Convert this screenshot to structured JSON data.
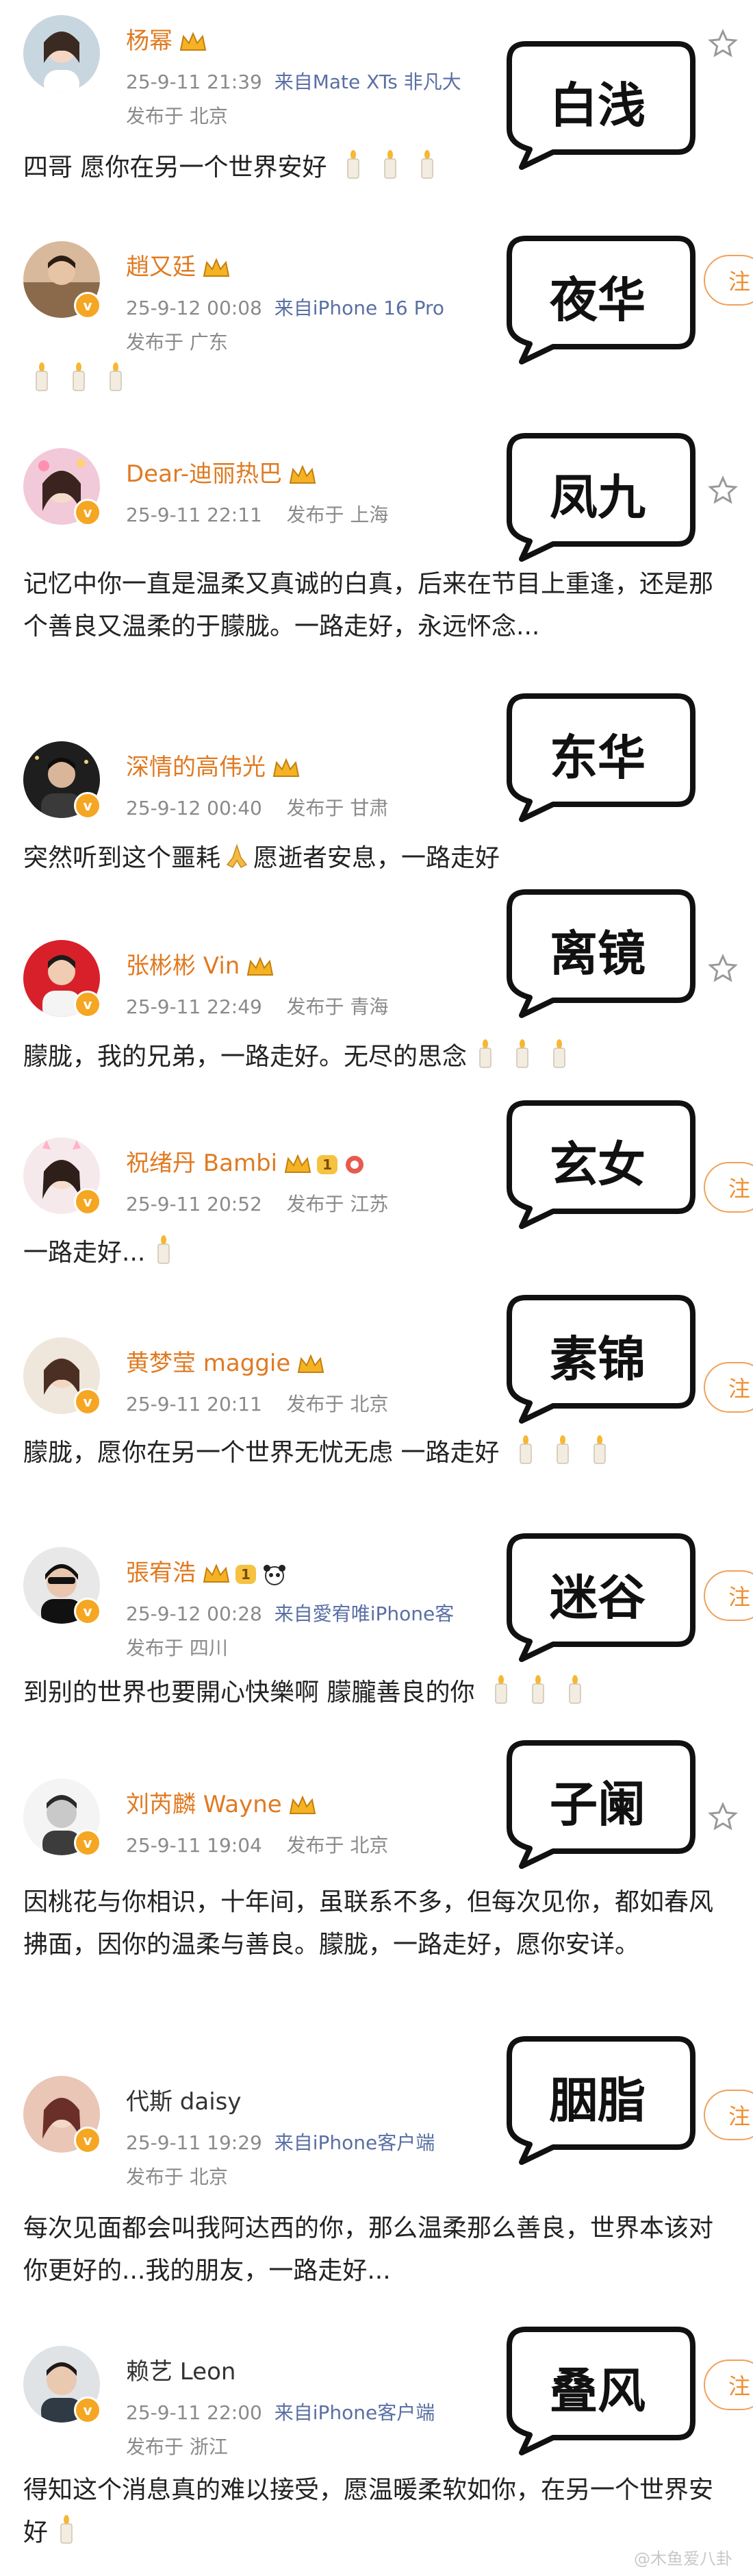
{
  "colors": {
    "username": "#e07a21",
    "badge": "#f5a623",
    "device": "#5a6fa3",
    "meta": "#8a8a8a"
  },
  "comments": [
    {
      "username": "杨幂",
      "time": "25-9-11 21:39",
      "device": "来自Mate XTs 非凡大",
      "location": "发布于 北京",
      "text": "四哥 愿你在另一个世界安好",
      "candles": 3,
      "overlay": "白浅"
    },
    {
      "username": "趙又廷",
      "time": "25-9-12 00:08",
      "device": "来自iPhone 16 Pro",
      "location": "发布于 广东",
      "text": "",
      "candles": 3,
      "overlay": "夜华"
    },
    {
      "username": "Dear-迪丽热巴",
      "time": "25-9-11 22:11",
      "device": "",
      "location": "发布于 上海",
      "text": "记忆中你一直是温柔又真诚的白真，后来在节目上重逢，还是那个善良又温柔的于朦胧。一路走好，永远怀念...",
      "candles": 0,
      "overlay": "凤九"
    },
    {
      "username": "深情的高伟光",
      "time": "25-9-12 00:40",
      "device": "",
      "location": "发布于 甘肃",
      "text_a": "突然听到这个噩耗",
      "text_b": "愿逝者安息，一路走好",
      "overlay": "东华"
    },
    {
      "username": "张彬彬 Vin",
      "time": "25-9-11 22:49",
      "device": "",
      "location": "发布于 青海",
      "text": "朦胧，我的兄弟，一路走好。无尽的思念",
      "candles": 3,
      "overlay": "离镜"
    },
    {
      "username": "祝绪丹 Bambi",
      "level": "1",
      "time": "25-9-11 20:52",
      "device": "",
      "location": "发布于 江苏",
      "text": "一路走好...",
      "candles": 1,
      "overlay": "玄女"
    },
    {
      "username": "黄梦莹 maggie",
      "time": "25-9-11 20:11",
      "device": "",
      "location": "发布于 北京",
      "text": "朦胧，愿你在另一个世界无忧无虑 一路走好",
      "candles": 3,
      "overlay": "素锦"
    },
    {
      "username": "張宥浩",
      "level": "1",
      "time": "25-9-12 00:28",
      "device": "来自愛宥唯iPhone客",
      "location": "发布于 四川",
      "text": "到别的世界也要開心快樂啊 朦朧善良的你",
      "candles": 3,
      "overlay": "迷谷"
    },
    {
      "username": "刘芮麟 Wayne",
      "time": "25-9-11 19:04",
      "device": "",
      "location": "发布于 北京",
      "text": "因桃花与你相识，十年间，虽联系不多，但每次见你，都如春风拂面，因你的温柔与善良。朦胧，一路走好，愿你安详。",
      "candles": 0,
      "overlay": "子阑"
    },
    {
      "username": "代斯 daisy",
      "time": "25-9-11 19:29",
      "device": "来自iPhone客户端",
      "location": "发布于 北京",
      "text": "每次见面都会叫我阿达西的你，那么温柔那么善良，世界本该对你更好的...我的朋友，一路走好...",
      "candles": 0,
      "overlay": "胭脂"
    },
    {
      "username": "赖艺 Leon",
      "time": "25-9-11 22:00",
      "device": "来自iPhone客户端",
      "location": "发布于 浙江",
      "text": "得知这个消息真的难以接受，愿温暖柔软如你，在另一个世界安好",
      "candles": 1,
      "overlay": "叠风"
    }
  ],
  "follow_label": "注",
  "watermark": "@木鱼爱八卦"
}
